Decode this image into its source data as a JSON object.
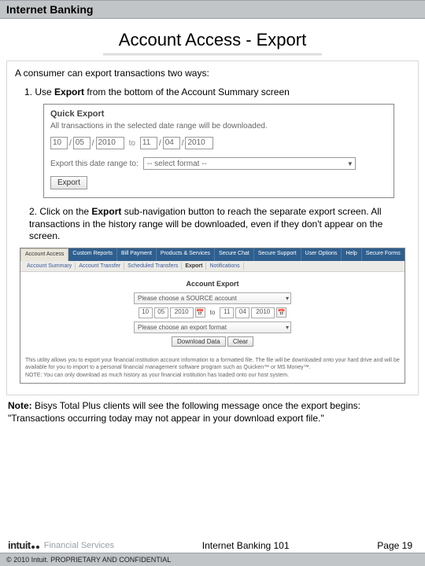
{
  "header": {
    "title": "Internet Banking"
  },
  "page": {
    "title": "Account Access - Export",
    "intro": "A consumer can export transactions two ways:",
    "item1_pre": "1.  Use ",
    "item1_bold": "Export",
    "item1_post": " from the bottom of the Account Summary screen",
    "item2_pre": "2.  Click on the ",
    "item2_bold": "Export",
    "item2_post": " sub-navigation button to reach the separate export screen. All transactions in the history range will be downloaded, even if they don't appear on the screen.",
    "note_label": "Note:",
    "note_text": " Bisys Total Plus clients will see the following message once the export begins: \"Transactions occurring today may not appear in your download export file.\""
  },
  "quick_export": {
    "title": "Quick Export",
    "desc": "All transactions in the selected date range will be downloaded.",
    "from": {
      "mm": "10",
      "dd": "05",
      "yyyy": "2010"
    },
    "to_label": "to",
    "to": {
      "mm": "11",
      "dd": "04",
      "yyyy": "2010"
    },
    "sep": "/",
    "format_label": "Export this date range to:",
    "format_value": "-- select format --",
    "button": "Export"
  },
  "account_export": {
    "tabs": [
      "Account Access",
      "Custom Reports",
      "Bill Payment",
      "Products & Services",
      "Secure Chat",
      "Secure Support",
      "User Options",
      "Help",
      "Secure Forms"
    ],
    "subtabs": [
      "Account Summary",
      "Account Transfer",
      "Scheduled Transfers",
      "Export",
      "Notifications"
    ],
    "active_tab": 0,
    "active_subtab": 3,
    "title": "Account Export",
    "source_value": "Please choose a SOURCE account",
    "from": {
      "mm": "10",
      "dd": "05",
      "yyyy": "2010"
    },
    "to_label": "to",
    "to": {
      "mm": "11",
      "dd": "04",
      "yyyy": "2010"
    },
    "format_value": "Please choose an export format",
    "btn_download": "Download Data",
    "btn_clear": "Clear",
    "help": "This utility allows you to export your financial institution account information to a formatted file. The file will be downloaded onto your hard drive and will be available for you to import to a personal financial management software program such as Quicken™ or MS Money™.",
    "note": "NOTE: You can only download as much history as your financial institution has loaded onto our host system."
  },
  "footer": {
    "brand1": "intuit",
    "brand2": "Financial Services",
    "center": "Internet Banking 101",
    "page": "Page 19",
    "copyright": "© 2010 Intuit.  PROPRIETARY AND CONFIDENTIAL"
  }
}
